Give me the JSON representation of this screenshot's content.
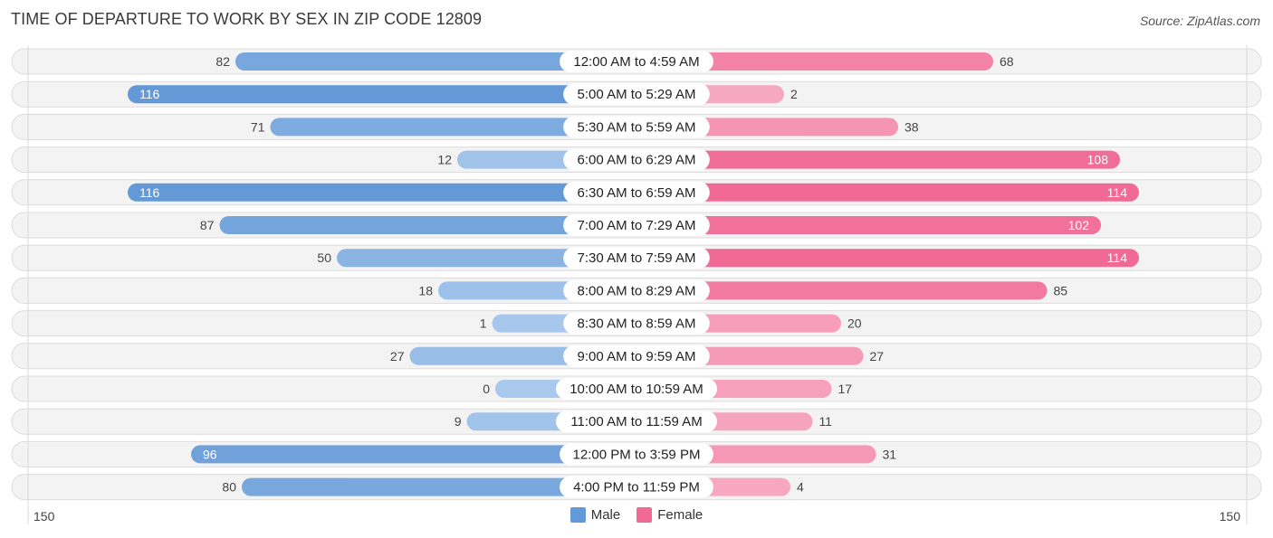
{
  "header": {
    "title": "TIME OF DEPARTURE TO WORK BY SEX IN ZIP CODE 12809",
    "source": "Source: ZipAtlas.com"
  },
  "colors": {
    "male_strong": "#6499d8",
    "male_light": "#a8c8ec",
    "female_strong": "#f06a95",
    "female_light": "#f7a9c2"
  },
  "legend": {
    "male": "Male",
    "female": "Female"
  },
  "axis": {
    "left_label": "150",
    "right_label": "150"
  },
  "chart_data": {
    "type": "bar",
    "orientation": "horizontal-diverging",
    "title": "TIME OF DEPARTURE TO WORK BY SEX IN ZIP CODE 12809",
    "xlabel": "",
    "ylabel": "",
    "xlim": [
      -150,
      150
    ],
    "legend_position": "bottom-center",
    "categories": [
      "12:00 AM to 4:59 AM",
      "5:00 AM to 5:29 AM",
      "5:30 AM to 5:59 AM",
      "6:00 AM to 6:29 AM",
      "6:30 AM to 6:59 AM",
      "7:00 AM to 7:29 AM",
      "7:30 AM to 7:59 AM",
      "8:00 AM to 8:29 AM",
      "8:30 AM to 8:59 AM",
      "9:00 AM to 9:59 AM",
      "10:00 AM to 10:59 AM",
      "11:00 AM to 11:59 AM",
      "12:00 PM to 3:59 PM",
      "4:00 PM to 11:59 PM"
    ],
    "series": [
      {
        "name": "Male",
        "values": [
          82,
          116,
          71,
          12,
          116,
          87,
          50,
          18,
          1,
          27,
          0,
          9,
          96,
          80
        ]
      },
      {
        "name": "Female",
        "values": [
          68,
          2,
          38,
          108,
          114,
          102,
          114,
          85,
          20,
          27,
          17,
          11,
          31,
          4
        ]
      }
    ]
  }
}
